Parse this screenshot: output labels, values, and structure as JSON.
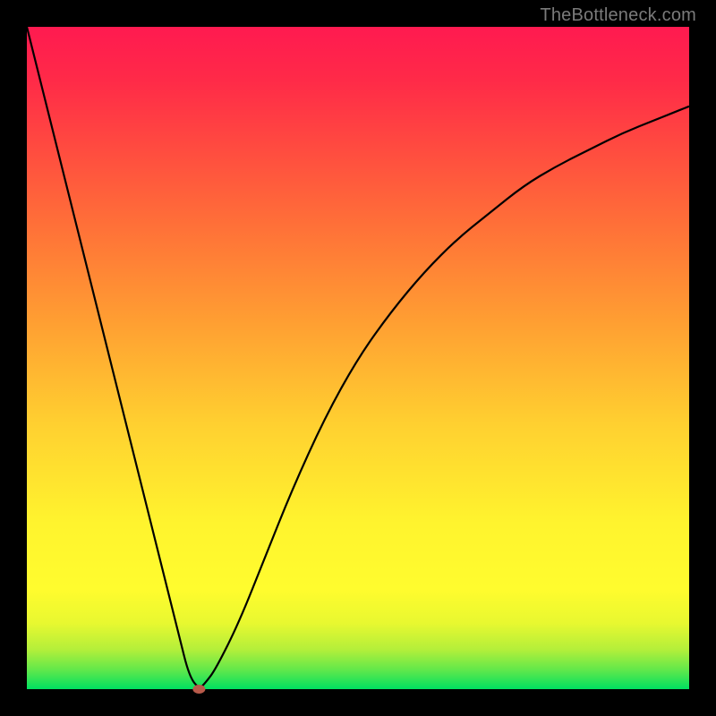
{
  "watermark": {
    "text": "TheBottleneck.com"
  },
  "chart_data": {
    "type": "line",
    "title": "",
    "xlabel": "",
    "ylabel": "",
    "xlim": [
      0,
      100
    ],
    "ylim": [
      0,
      100
    ],
    "grid": false,
    "background": "red-yellow-green vertical gradient",
    "series": [
      {
        "name": "curve",
        "x": [
          0,
          5,
          10,
          15,
          20,
          23,
          24.5,
          26,
          27,
          28.5,
          32,
          36,
          40,
          45,
          50,
          55,
          60,
          65,
          70,
          75,
          80,
          85,
          90,
          95,
          100
        ],
        "y": [
          100,
          80,
          60,
          40,
          20,
          8,
          2,
          0,
          1,
          3,
          10,
          20,
          30,
          41,
          50,
          57,
          63,
          68,
          72,
          76,
          79,
          81.5,
          84,
          86,
          88
        ]
      }
    ],
    "marker": {
      "x": 26,
      "y": 0,
      "color": "#b85a4a"
    }
  }
}
